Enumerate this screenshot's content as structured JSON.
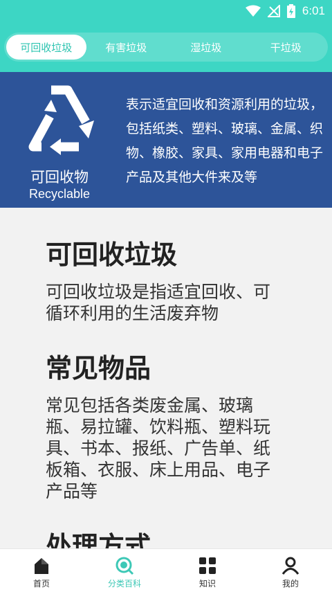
{
  "status_bar": {
    "time": "6:01"
  },
  "tabs": [
    {
      "label": "可回收垃圾",
      "active": true
    },
    {
      "label": "有害垃圾",
      "active": false
    },
    {
      "label": "湿垃圾",
      "active": false
    },
    {
      "label": "干垃圾",
      "active": false
    }
  ],
  "banner": {
    "icon": "recycle-icon",
    "title": "可回收物",
    "subtitle": "Recyclable",
    "description": "表示适宜回收和资源利用的垃圾，包括纸类、塑料、玻璃、金属、织物、橡胶、家具、家用电器和电子产品及其他大件来及等"
  },
  "sections": [
    {
      "title": "可回收垃圾",
      "body": "可回收垃圾是指适宜回收、可循环利用的生活废弃物"
    },
    {
      "title": "常见物品",
      "body": "常见包括各类废金属、玻璃瓶、易拉罐、饮料瓶、塑料玩具、书本、报纸、广告单、纸板箱、衣服、床上用品、电子产品等"
    },
    {
      "title": "处理方式",
      "body": ""
    }
  ],
  "bottom_nav": [
    {
      "label": "首页",
      "icon": "home-icon",
      "active": false
    },
    {
      "label": "分类百科",
      "icon": "search-icon",
      "active": true
    },
    {
      "label": "知识",
      "icon": "grid-icon",
      "active": false
    },
    {
      "label": "我的",
      "icon": "user-icon",
      "active": false
    }
  ],
  "colors": {
    "primary": "#3dd6c4",
    "banner": "#2d5499",
    "active_text": "#2ec4b1"
  }
}
